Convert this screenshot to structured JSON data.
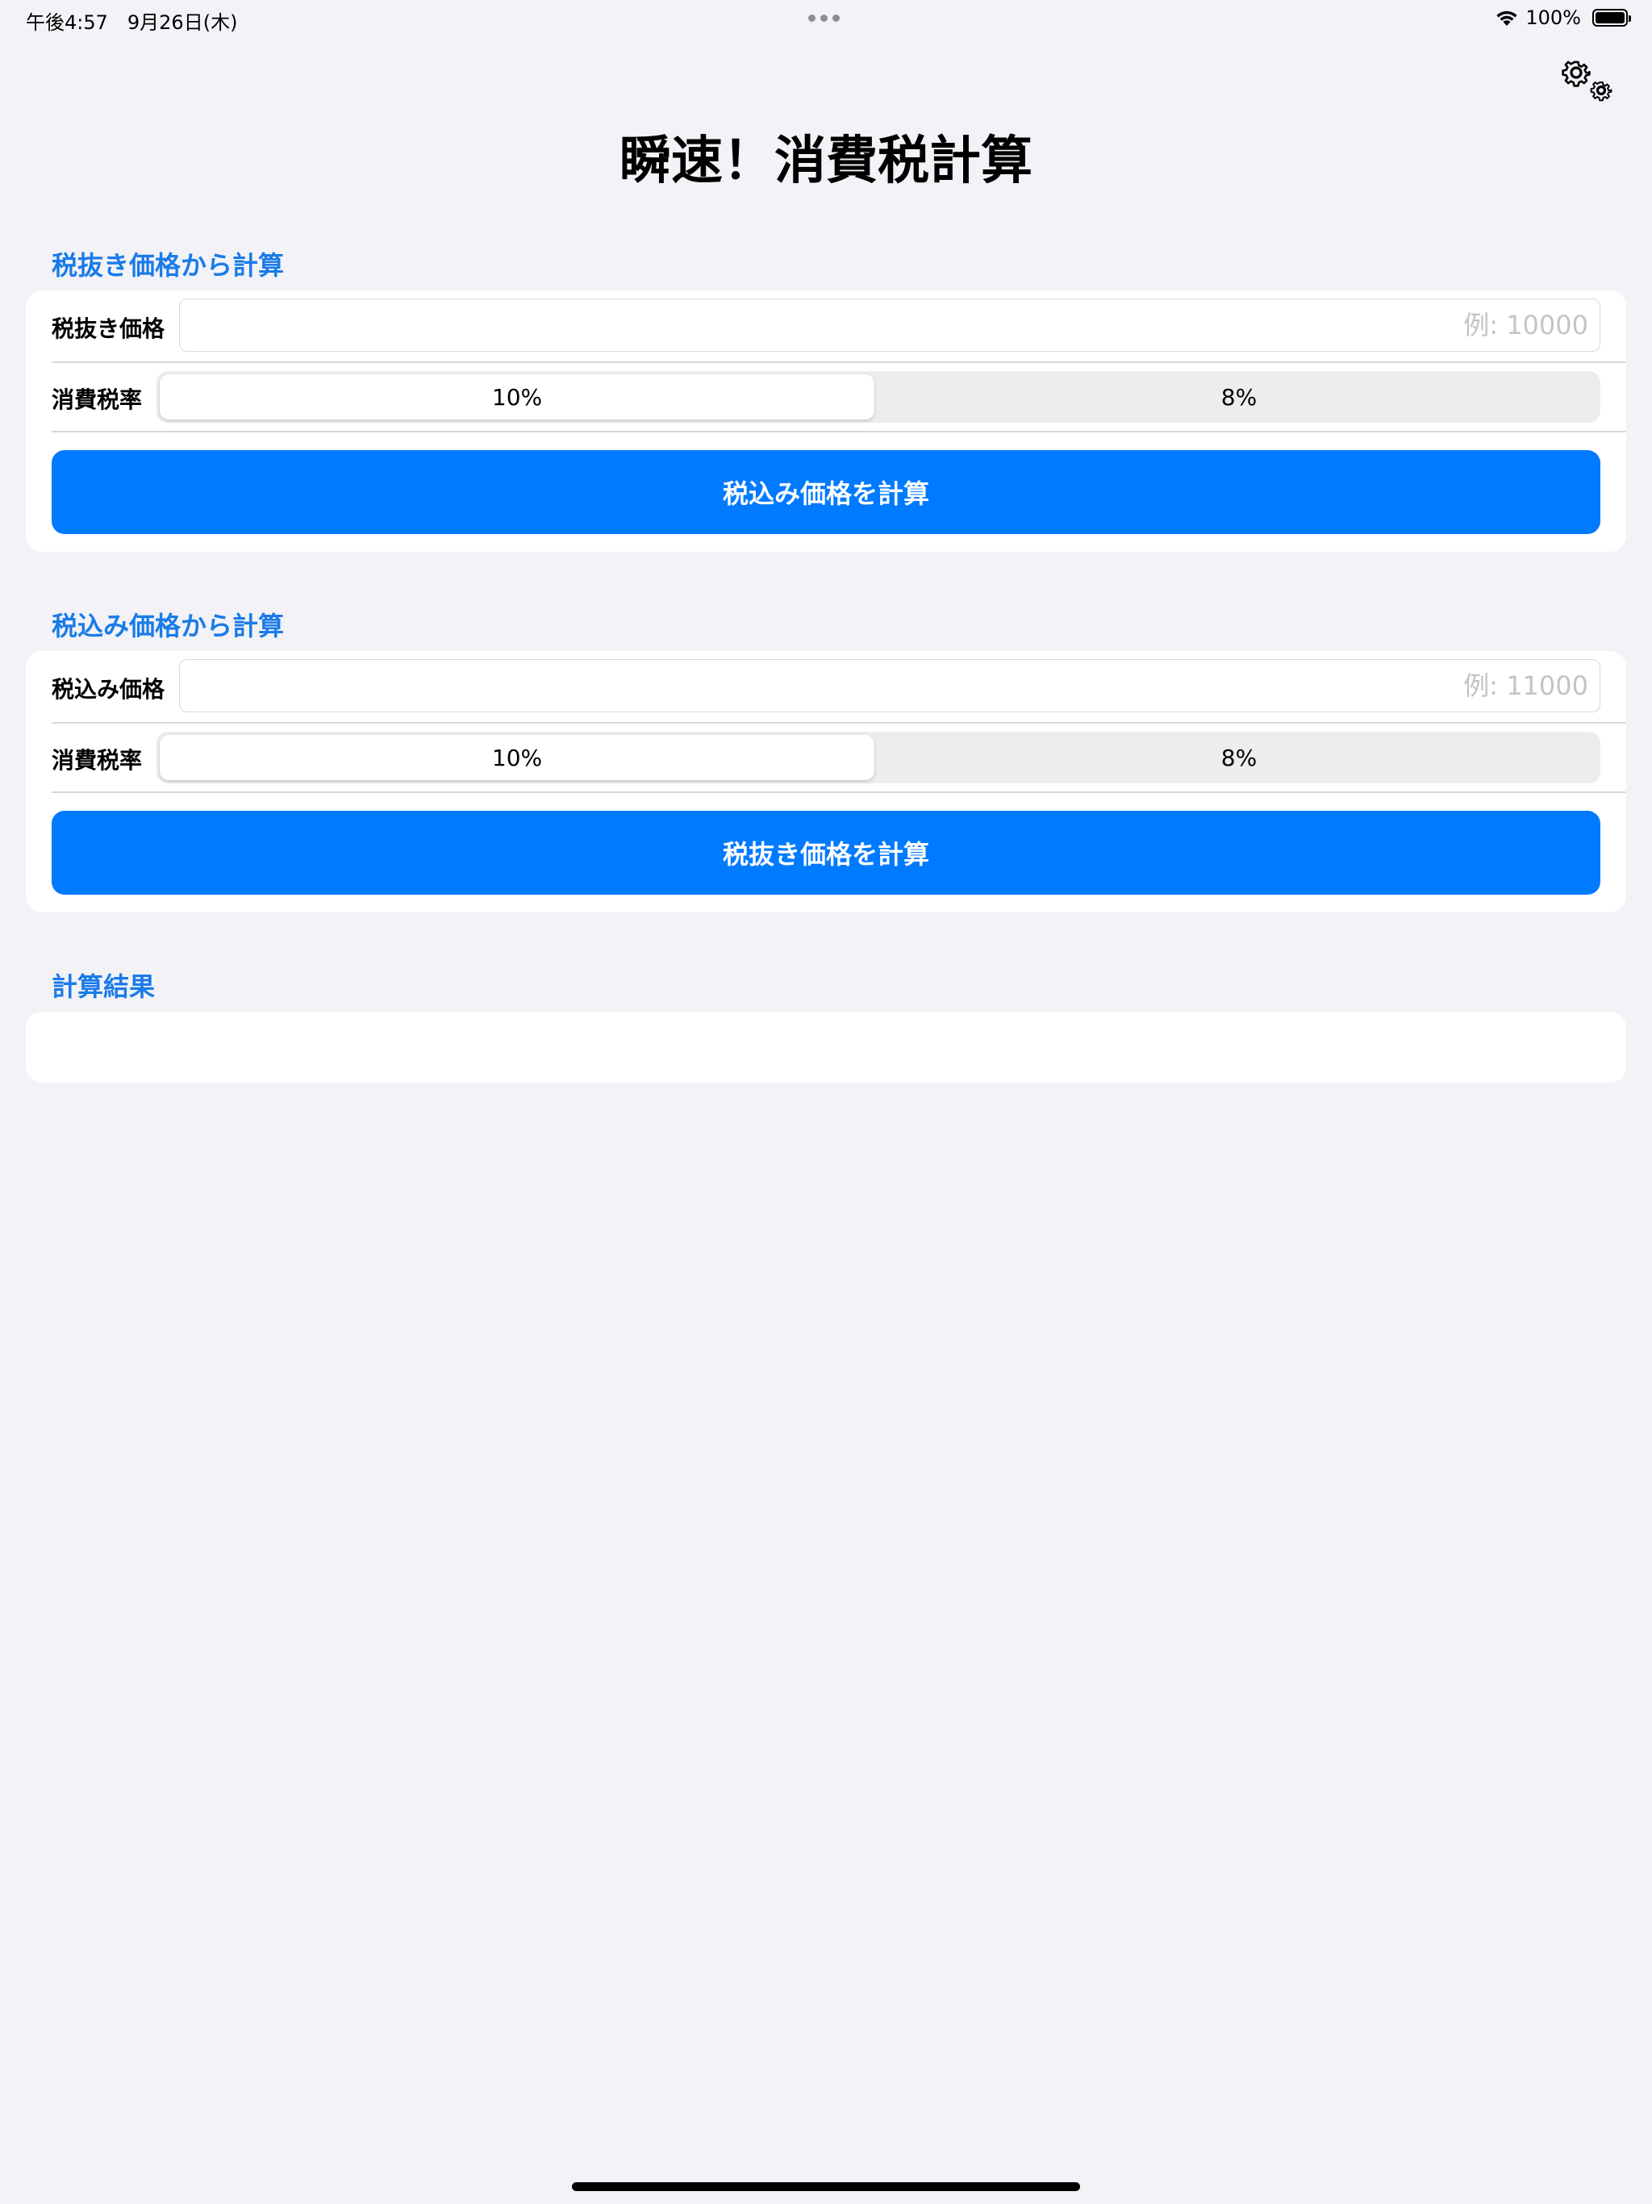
{
  "status_bar": {
    "time_date": "午後4:57　9月26日(木)",
    "battery_percent": "100%",
    "battery_level": 100
  },
  "title": "瞬速！消費税計算",
  "settings": {
    "icon": "gears-icon"
  },
  "section_exclusive": {
    "header": "税抜き価格から計算",
    "price_label": "税抜き価格",
    "price_placeholder": "例: 10000",
    "price_value": "",
    "rate_label": "消費税率",
    "rate_options": [
      "10%",
      "8%"
    ],
    "rate_selected": "10%",
    "button_label": "税込み価格を計算"
  },
  "section_inclusive": {
    "header": "税込み価格から計算",
    "price_label": "税込み価格",
    "price_placeholder": "例: 11000",
    "price_value": "",
    "rate_label": "消費税率",
    "rate_options": [
      "10%",
      "8%"
    ],
    "rate_selected": "10%",
    "button_label": "税抜き価格を計算"
  },
  "result": {
    "header": "計算結果",
    "text": ""
  },
  "colors": {
    "accent": "#007aff",
    "section_header": "#1a7be8",
    "background": "#f2f2f7"
  }
}
